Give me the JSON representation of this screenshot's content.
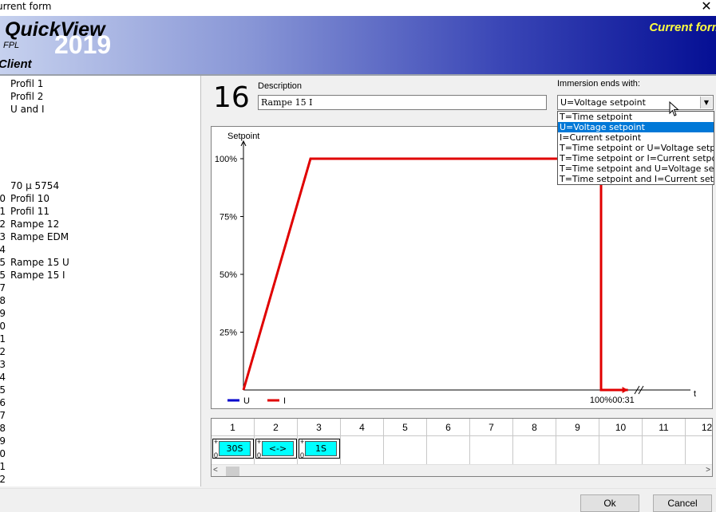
{
  "window": {
    "title": "urrent form",
    "close_glyph": "✕"
  },
  "banner": {
    "brand": "QuickView",
    "year": "2019",
    "sub": "FPL",
    "client": "Client",
    "form_name": "Current form"
  },
  "profile_list": [
    {
      "num": "",
      "name": "Profil 1"
    },
    {
      "num": "",
      "name": "Profil 2"
    },
    {
      "num": "",
      "name": "U and I"
    },
    {
      "num": "",
      "name": ""
    },
    {
      "num": "",
      "name": ""
    },
    {
      "num": "",
      "name": ""
    },
    {
      "num": "",
      "name": ""
    },
    {
      "num": "",
      "name": ""
    },
    {
      "num": "",
      "name": "70 µ 5754"
    },
    {
      "num": "0",
      "name": "Profil 10"
    },
    {
      "num": "1",
      "name": "Profil 11"
    },
    {
      "num": "2",
      "name": "Rampe 12"
    },
    {
      "num": "3",
      "name": "Rampe EDM"
    },
    {
      "num": "4",
      "name": ""
    },
    {
      "num": "5",
      "name": "Rampe 15 U"
    },
    {
      "num": "5",
      "name": "Rampe 15 I"
    },
    {
      "num": "7",
      "name": ""
    },
    {
      "num": "8",
      "name": ""
    },
    {
      "num": "9",
      "name": ""
    },
    {
      "num": "0",
      "name": ""
    },
    {
      "num": "1",
      "name": ""
    },
    {
      "num": "2",
      "name": ""
    },
    {
      "num": "3",
      "name": ""
    },
    {
      "num": "4",
      "name": ""
    },
    {
      "num": "5",
      "name": ""
    },
    {
      "num": "6",
      "name": ""
    },
    {
      "num": "7",
      "name": ""
    },
    {
      "num": "8",
      "name": ""
    },
    {
      "num": "9",
      "name": ""
    },
    {
      "num": "0",
      "name": ""
    },
    {
      "num": "1",
      "name": ""
    },
    {
      "num": "2",
      "name": ""
    }
  ],
  "profile": {
    "number": "16",
    "description_label": "Description",
    "description_value": "Rampe 15 I"
  },
  "immersion": {
    "label": "Immersion ends with:",
    "selected": "U=Voltage setpoint",
    "options": [
      "T=Time setpoint",
      "U=Voltage setpoint",
      "I=Current setpoint",
      "T=Time setpoint or U=Voltage setpoint",
      "T=Time setpoint or I=Current setpoint",
      "T=Time setpoint and U=Voltage setpoint",
      "T=Time setpoint and I=Current setpoint"
    ],
    "selected_index": 1
  },
  "chart_data": {
    "type": "line",
    "ylabel": "Setpoint",
    "xlabel": "t",
    "yticks": [
      "100%",
      "75%",
      "50%",
      "25%"
    ],
    "ytick_values": [
      100,
      75,
      50,
      25
    ],
    "ylim": [
      0,
      100
    ],
    "x_annotations": [
      "00:31",
      "100%"
    ],
    "legend": [
      "U",
      "I"
    ],
    "legend_colors": [
      "#0000cc",
      "#e00000"
    ],
    "series": [
      {
        "name": "I",
        "x": [
          0,
          0.15,
          0.8,
          0.8,
          0.86
        ],
        "y": [
          0,
          100,
          100,
          0,
          0
        ]
      }
    ]
  },
  "steps": {
    "columns": [
      "1",
      "2",
      "3",
      "4",
      "5",
      "6",
      "7",
      "8",
      "9",
      "10",
      "11",
      "12"
    ],
    "items": [
      {
        "col": 0,
        "label": "30S"
      },
      {
        "col": 1,
        "label": "<->"
      },
      {
        "col": 2,
        "label": "1S"
      }
    ],
    "plus": "+",
    "zero": "0",
    "scroll_left": "<",
    "scroll_right": ">"
  },
  "buttons": {
    "ok": "Ok",
    "cancel": "Cancel"
  }
}
